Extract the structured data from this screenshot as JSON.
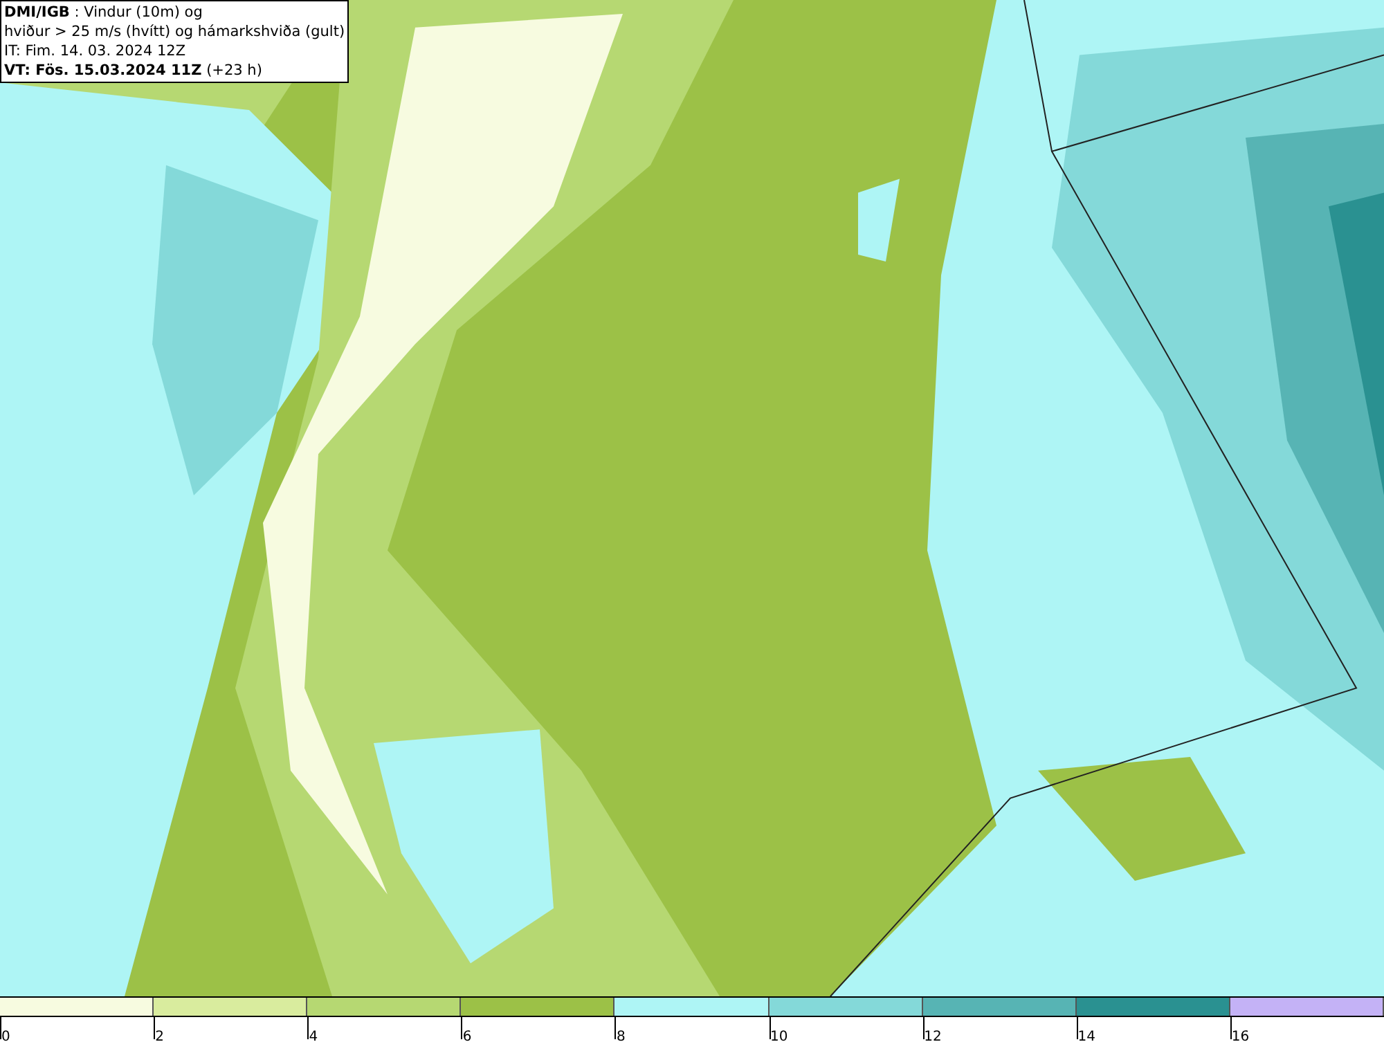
{
  "title_box": {
    "lines": [
      "**DMI/IGB** : Vindur (10m) og",
      "hviður > 25 m/s (hvítt) og hámarkshviða (gult)",
      "IT: Fim. 14. 03. 2024 12Z",
      "**VT: Fös. 15.03.2024 11Z** (+23 h)"
    ]
  },
  "legend": {
    "bins": [
      {
        "color": "#f7fbe0",
        "label": "0"
      },
      {
        "color": "#d9ec9e",
        "label": "2"
      },
      {
        "color": "#b6d872",
        "label": "4"
      },
      {
        "color": "#9cc147",
        "label": "6"
      },
      {
        "color": "#aef5f5",
        "label": "8"
      },
      {
        "color": "#84d9d9",
        "label": "10"
      },
      {
        "color": "#57b4b4",
        "label": "12"
      },
      {
        "color": "#2a9191",
        "label": "14"
      },
      {
        "color": "#c4b2f6",
        "label": "16"
      }
    ]
  }
}
